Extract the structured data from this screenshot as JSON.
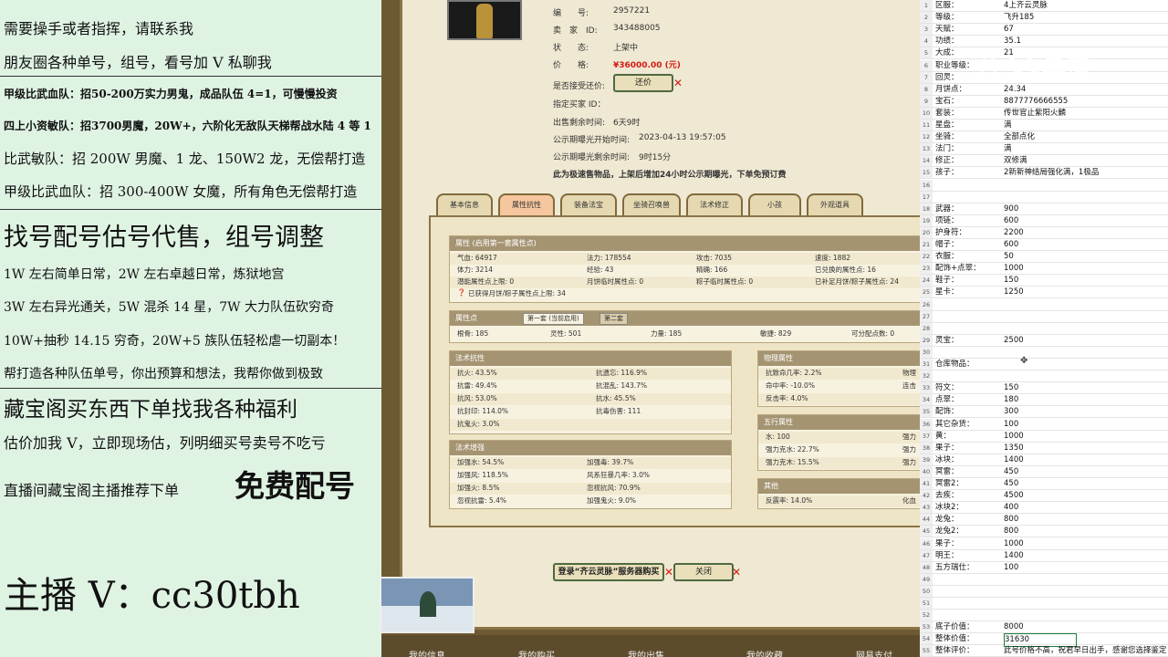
{
  "left_ad": {
    "lines": [
      "需要操手或者指挥，请联系我",
      "朋友圈各种单号，组号，看号加 V 私聊我",
      "甲级比武血队：招50-200万实力男鬼，成品队伍 4=1，可慢慢投资",
      "四上小资敏队：招3700男魔，20W+，六阶化无敌队天梯帮战水陆 4 等 1",
      "比武敏队：招 200W 男魔、1 龙、150W2 龙，无偿帮打造",
      "甲级比武血队：招 300-400W 女魔，所有角色无偿帮打造",
      "找号配号估号代售，组号调整",
      "1W 左右简单日常，2W 左右卓越日常，炼狱地宫",
      "3W 左右异光通关，5W 混杀 14 星，7W 大力队伍砍穷奇",
      "10W+抽秒 14.15 穷奇，20W+5 族队伍轻松虐一切副本！",
      "帮打造各种队伍单号，你出预算和想法，我帮你做到极致",
      "藏宝阁买东西下单找我各种福利",
      "估价加我 V，立即现场估，列明细买号卖号不吃亏",
      "直播间藏宝阁主播推荐下单",
      "免费配号",
      "主播 V：cc30tbh"
    ]
  },
  "game": {
    "info": {
      "number_label": "编　　号:",
      "number_value": "2957221",
      "seller_label": "卖　家　ID:",
      "seller_value": "343488005",
      "status_label": "状　　态:",
      "status_value": "上架中",
      "price_label": "价　　格:",
      "price_value": "¥36000.00 (元)",
      "bargain_label": "是否接受还价:",
      "bargain_button": "还价",
      "buyer_label": "指定买家 ID：",
      "remaining_label": "出售剩余时间:",
      "remaining_value": "6天9时",
      "public_start_label": "公示期曝光开始时间:",
      "public_start_value": "2023-04-13 19:57:05",
      "public_remain_label": "公示期曝光剩余时间:",
      "public_remain_value": "9时15分",
      "notice": "此为极速售物品，上架后增加24小时公示期曝光，下单免预订费"
    },
    "tabs": [
      "基本信息",
      "属性抗性",
      "装备法宝",
      "坐骑召唤兽",
      "法术修正",
      "小孩",
      "外观道具"
    ],
    "attr_panel": {
      "title": "属性 (启用第一套属性点)",
      "rows": [
        [
          "气血: 64917",
          "法力: 178554",
          "攻击: 7035",
          "速度: 1882"
        ],
        [
          "体力: 3214",
          "经验: 43",
          "精确: 166",
          "已兑换的属性点: 16"
        ],
        [
          "潜能属性点上限: 0",
          "月饼临时属性点: 0",
          "粽子临时属性点: 0",
          "已补足月饼/粽子属性点: 24"
        ],
        [
          "已获得月饼/粽子属性点上限: 34"
        ]
      ]
    },
    "points_panel": {
      "title": "属性点",
      "tab1": "第一套 (当前启用)",
      "tab2": "第二套",
      "row": [
        "根骨: 185",
        "灵性: 501",
        "力量: 185",
        "敏捷: 829",
        "可分配点数: 0"
      ]
    },
    "resist_panel": {
      "title": "法术抗性",
      "rows": [
        [
          "抗火: 43.5%",
          "抗遗忘: 116.9%"
        ],
        [
          "抗雷: 49.4%",
          "抗混乱: 143.7%"
        ],
        [
          "抗风: 53.0%",
          "抗水: 45.5%"
        ],
        [
          "抗封印: 114.0%",
          "抗毒伤害: 111"
        ],
        [
          "抗鬼火: 3.0%",
          ""
        ]
      ]
    },
    "boost_panel": {
      "title": "法术增强",
      "rows": [
        [
          "加强水: 54.5%",
          "加强毒: 39.7%"
        ],
        [
          "加强风: 118.5%",
          "风系狂暴几率: 3.0%"
        ],
        [
          "加强火: 8.5%",
          "忽视抗风: 70.9%"
        ],
        [
          "忽视抗雷: 5.4%",
          "加强鬼火: 9.0%"
        ]
      ]
    },
    "phys_panel": {
      "title": "物理属性",
      "rows": [
        [
          "抗致命几率: 2.2%",
          "物理"
        ],
        [
          "命中率: -10.0%",
          "连击"
        ],
        [
          "反击率: 4.0%",
          ""
        ]
      ]
    },
    "five_panel": {
      "title": "五行属性",
      "rows": [
        [
          "水: 100",
          "强力"
        ],
        [
          "强力克水: 22.7%",
          "强力"
        ],
        [
          "强力克木: 15.5%",
          "强力"
        ]
      ]
    },
    "other_panel": {
      "title": "其他",
      "rows": [
        [
          "反震率: 14.0%",
          "化血"
        ]
      ]
    },
    "login_button": "登录“齐云灵脉”服务器购买",
    "close_button": "关闭",
    "bottom_tabs": [
      "我的信息",
      "我的购买",
      "我的出售",
      "我的收藏",
      "网易支付"
    ]
  },
  "sheet": {
    "rows": [
      [
        "1",
        "区服：",
        "4上齐云灵脉"
      ],
      [
        "2",
        "等级：",
        "飞升185"
      ],
      [
        "3",
        "天赋：",
        "67"
      ],
      [
        "4",
        "功绩：",
        "35.1"
      ],
      [
        "5",
        "大成：",
        "21"
      ],
      [
        "6",
        "职业等级：",
        ""
      ],
      [
        "7",
        "回灵：",
        ""
      ],
      [
        "8",
        "月饼点：",
        "24.34"
      ],
      [
        "9",
        "宝石：",
        "8877776666555"
      ],
      [
        "10",
        "套装：",
        "传世官止紫阳火麟"
      ],
      [
        "11",
        "星盘：",
        "满"
      ],
      [
        "12",
        "坐骑：",
        "全部点化"
      ],
      [
        "13",
        "法门：",
        "满"
      ],
      [
        "14",
        "修正：",
        "双修满"
      ],
      [
        "15",
        "孩子：",
        "2新新神结局强化满，1极品"
      ],
      [
        "16",
        "",
        ""
      ],
      [
        "17",
        "",
        ""
      ],
      [
        "18",
        "武器：",
        "900"
      ],
      [
        "19",
        "项链：",
        "600"
      ],
      [
        "20",
        "护身符：",
        "2200"
      ],
      [
        "21",
        "帽子：",
        "600"
      ],
      [
        "22",
        "衣服：",
        "50"
      ],
      [
        "23",
        "配饰+点翠：",
        "1000"
      ],
      [
        "24",
        "鞋子：",
        "150"
      ],
      [
        "25",
        "星卡：",
        "1250"
      ],
      [
        "26",
        "",
        ""
      ],
      [
        "27",
        "",
        ""
      ],
      [
        "28",
        "",
        ""
      ],
      [
        "29",
        "灵宝：",
        "2500"
      ],
      [
        "30",
        "",
        ""
      ],
      [
        "31",
        "仓库物品：",
        ""
      ],
      [
        "32",
        "",
        ""
      ],
      [
        "33",
        "符文：",
        "150"
      ],
      [
        "34",
        "点翠：",
        "180"
      ],
      [
        "35",
        "配饰：",
        "300"
      ],
      [
        "36",
        "其它杂货：",
        "100"
      ],
      [
        "37",
        "黄：",
        "1000"
      ],
      [
        "38",
        "果子：",
        "1350"
      ],
      [
        "39",
        "冰块：",
        "1400"
      ],
      [
        "40",
        "冥雷：",
        "450"
      ],
      [
        "41",
        "冥雷2：",
        "450"
      ],
      [
        "42",
        "去疾：",
        "4500"
      ],
      [
        "43",
        "冰块2：",
        "400"
      ],
      [
        "44",
        "龙兔：",
        "800"
      ],
      [
        "45",
        "龙兔2：",
        "800"
      ],
      [
        "46",
        "果子：",
        "1000"
      ],
      [
        "47",
        "明王：",
        "1400"
      ],
      [
        "48",
        "五方瑞仕：",
        "100"
      ],
      [
        "49",
        "",
        ""
      ],
      [
        "50",
        "",
        ""
      ],
      [
        "51",
        "",
        ""
      ],
      [
        "52",
        "",
        ""
      ],
      [
        "53",
        "底子价值：",
        "8000"
      ],
      [
        "54",
        "整体价值：",
        "31630"
      ],
      [
        "55",
        "整体评价：",
        "此号价格不高，祝君早日出手，感谢您选择鉴定"
      ]
    ]
  },
  "watermark": "CC直播"
}
